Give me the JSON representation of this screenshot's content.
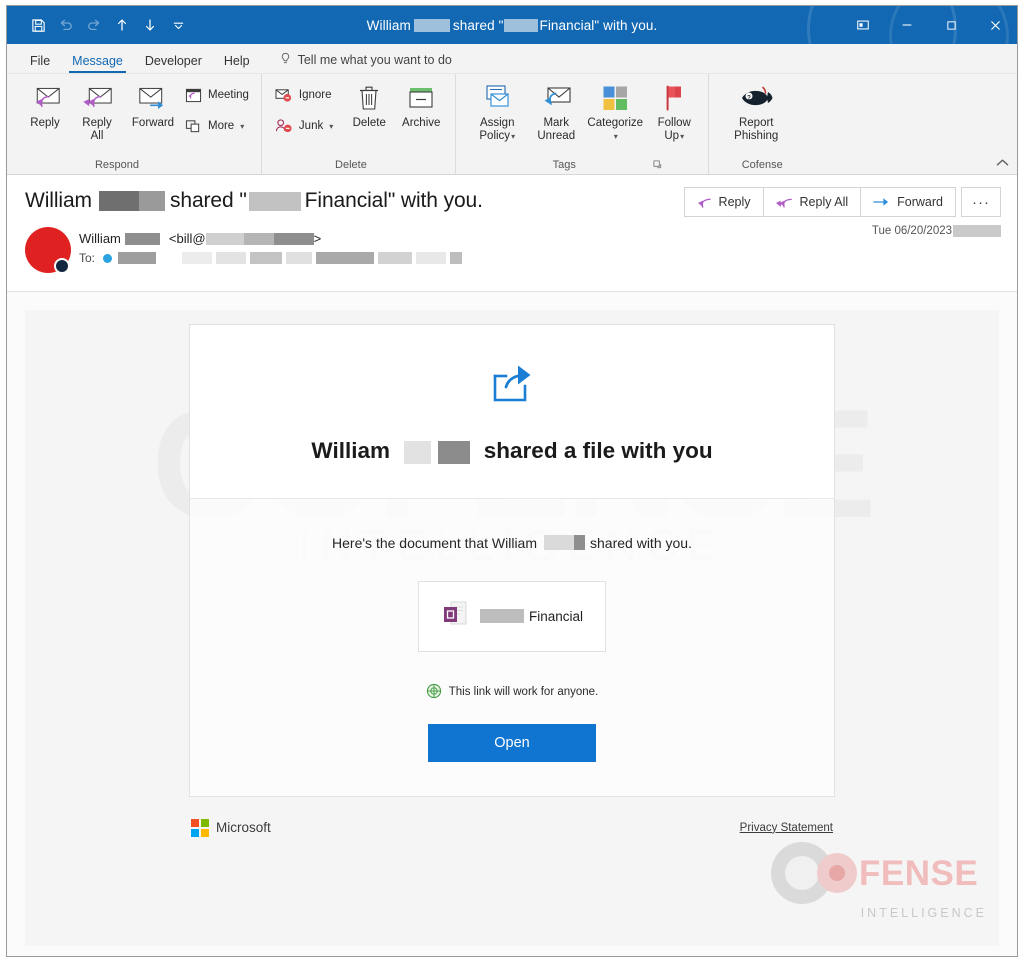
{
  "window": {
    "title_prefix": "William",
    "title_mid": "shared \"",
    "title_suffix": "Financial\" with you.",
    "accent_color": "#1268b3"
  },
  "quick_access": {
    "items": [
      {
        "name": "save-icon",
        "label": "Save"
      },
      {
        "name": "undo-icon",
        "label": "Undo"
      },
      {
        "name": "redo-icon",
        "label": "Redo"
      },
      {
        "name": "previous-item-icon",
        "label": "Previous Item"
      },
      {
        "name": "next-item-icon",
        "label": "Next Item"
      },
      {
        "name": "customize-quick-access-icon",
        "label": "Customize Quick Access Toolbar"
      }
    ]
  },
  "window_controls": {
    "restore_pane_label": "Restore Pane",
    "minimize_label": "Minimize",
    "maximize_label": "Maximize",
    "close_label": "Close"
  },
  "tabs": [
    {
      "label": "File",
      "active": false
    },
    {
      "label": "Message",
      "active": true
    },
    {
      "label": "Developer",
      "active": false
    },
    {
      "label": "Help",
      "active": false
    }
  ],
  "tell_me": {
    "placeholder": "Tell me what you want to do"
  },
  "ribbon": {
    "groups": [
      {
        "label": "Respond",
        "big_buttons": [
          {
            "label": "Reply",
            "icon": "reply-icon"
          },
          {
            "label": "Reply\nAll",
            "line1": "Reply",
            "line2": "All",
            "icon": "reply-all-icon"
          },
          {
            "label": "Forward",
            "icon": "forward-icon"
          }
        ],
        "small_buttons": [
          {
            "label": "Meeting",
            "icon": "meeting-icon",
            "caret": false
          },
          {
            "label": "More",
            "icon": "more-icon",
            "caret": true
          }
        ]
      },
      {
        "label": "Delete",
        "small_buttons": [
          {
            "label": "Ignore",
            "icon": "ignore-icon",
            "caret": false
          },
          {
            "label": "Junk",
            "icon": "junk-icon",
            "caret": true
          }
        ],
        "big_buttons": [
          {
            "label": "Delete",
            "icon": "delete-icon"
          },
          {
            "label": "Archive",
            "icon": "archive-icon"
          }
        ]
      },
      {
        "label": "Tags",
        "has_dialog_launcher": true,
        "big_buttons": [
          {
            "line1": "Assign",
            "line2": "Policy",
            "icon": "assign-policy-icon",
            "caret": true
          },
          {
            "line1": "Mark",
            "line2": "Unread",
            "icon": "mark-unread-icon",
            "caret": false
          },
          {
            "line1": "Categorize",
            "line2": "",
            "icon": "categorize-icon",
            "caret": true
          },
          {
            "line1": "Follow",
            "line2": "Up",
            "icon": "follow-up-icon",
            "caret": true
          }
        ]
      },
      {
        "label": "Cofense",
        "big_buttons": [
          {
            "line1": "Report",
            "line2": "Phishing",
            "icon": "report-phishing-icon",
            "caret": false
          }
        ]
      }
    ],
    "collapse_label": "Collapse the Ribbon"
  },
  "message": {
    "subject_prefix": "William",
    "subject_mid": "shared \"",
    "subject_suffix": "Financial\" with you.",
    "sender_name": "William",
    "sender_email_open": "<bill@",
    "sender_email_close": ">",
    "to_label": "To:",
    "date": "Tue 06/20/2023",
    "actions": [
      {
        "label": "Reply",
        "icon": "reply-icon"
      },
      {
        "label": "Reply All",
        "icon": "reply-all-icon"
      },
      {
        "label": "Forward",
        "icon": "forward-icon"
      }
    ],
    "more_actions_label": "···"
  },
  "email_body": {
    "background_watermark": "COFENSE",
    "background_watermark_sub": "INTELLIGENCE",
    "share_icon": "share-icon",
    "headline_prefix": "William",
    "headline_suffix": "shared a file with you",
    "doc_line_prefix": "Here's the document that William",
    "doc_line_suffix": "shared with you.",
    "file_icon": "onenote-file-icon",
    "file_name_suffix": "Financial",
    "link_note": "This link will work for anyone.",
    "link_note_icon": "globe-icon",
    "open_button": "Open",
    "open_button_color": "#0f75d1",
    "microsoft_label": "Microsoft",
    "privacy_label": "Privacy Statement"
  },
  "cofense_logo": {
    "word": "FENSE",
    "sub": "INTELLIGENCE"
  }
}
